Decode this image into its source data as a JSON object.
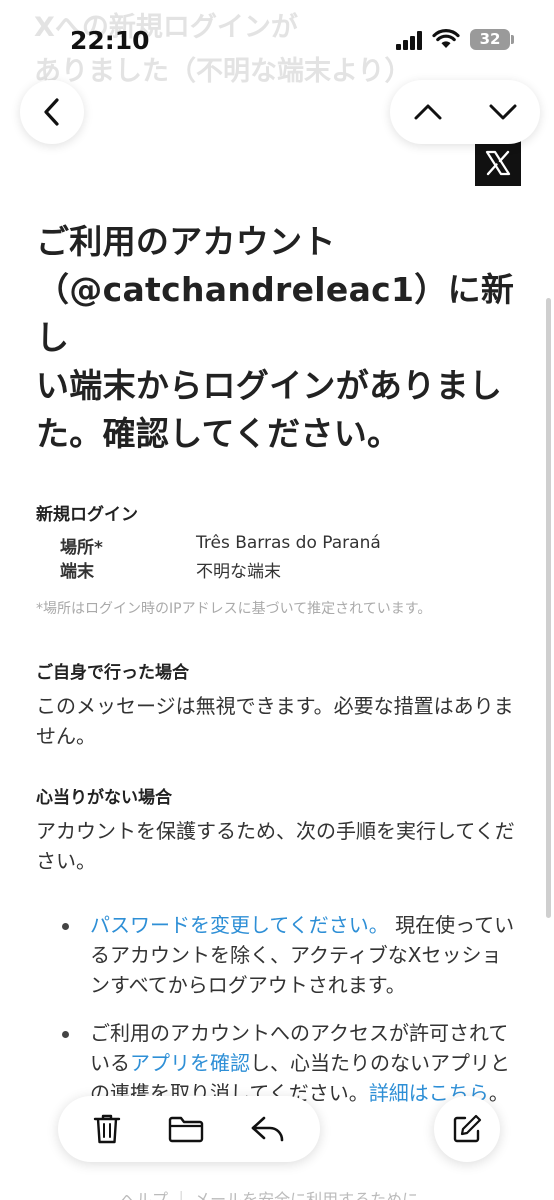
{
  "status": {
    "time": "22:10",
    "battery": "32"
  },
  "header": {
    "subject_line1": "Xへの新規ログインが",
    "subject_line2": "ありました（不明な端末より）"
  },
  "email": {
    "headline_lines": [
      "ご利用のアカウント",
      "（@catchandreleac1）に新し",
      "い端末からログインがありまし",
      "た。確認してください。"
    ],
    "login": {
      "title": "新規ログイン",
      "location_label": "場所*",
      "location_value": "Três Barras do Paraná",
      "device_label": "端末",
      "device_value": "不明な端末"
    },
    "note": "*場所はログイン時のIPアドレスに基づいて推定されています。",
    "own": {
      "title": "ご自身で行った場合",
      "body": "このメッセージは無視できます。必要な措置はありません。"
    },
    "noidea": {
      "title": "心当りがない場合",
      "body": "アカウントを保護するため、次の手順を実行してください。"
    },
    "bullet1": {
      "link": "パスワードを変更してください。",
      "text": " 現在使っているアカウントを除く、アクティブなXセッションすべてからログアウトされます。"
    },
    "bullet2": {
      "text_a": "ご利用のアカウントへのアクセスが許可されている",
      "link_a": "アプリを確認",
      "text_b": "し、心当たりのないアプリとの連携を取り消してください。",
      "link_b": "詳細はこちら",
      "text_c": "。"
    }
  },
  "footer": {
    "text": "ヘルプ ｜ メールを安全に利用するために"
  },
  "icons": {
    "back": "chevron-left-icon",
    "up": "chevron-up-icon",
    "down": "chevron-down-icon",
    "trash": "trash-icon",
    "folder": "folder-icon",
    "reply": "reply-icon",
    "compose": "compose-icon"
  },
  "colors": {
    "link": "#2e8fd6",
    "text": "#222222",
    "note": "#aaaaaa"
  }
}
